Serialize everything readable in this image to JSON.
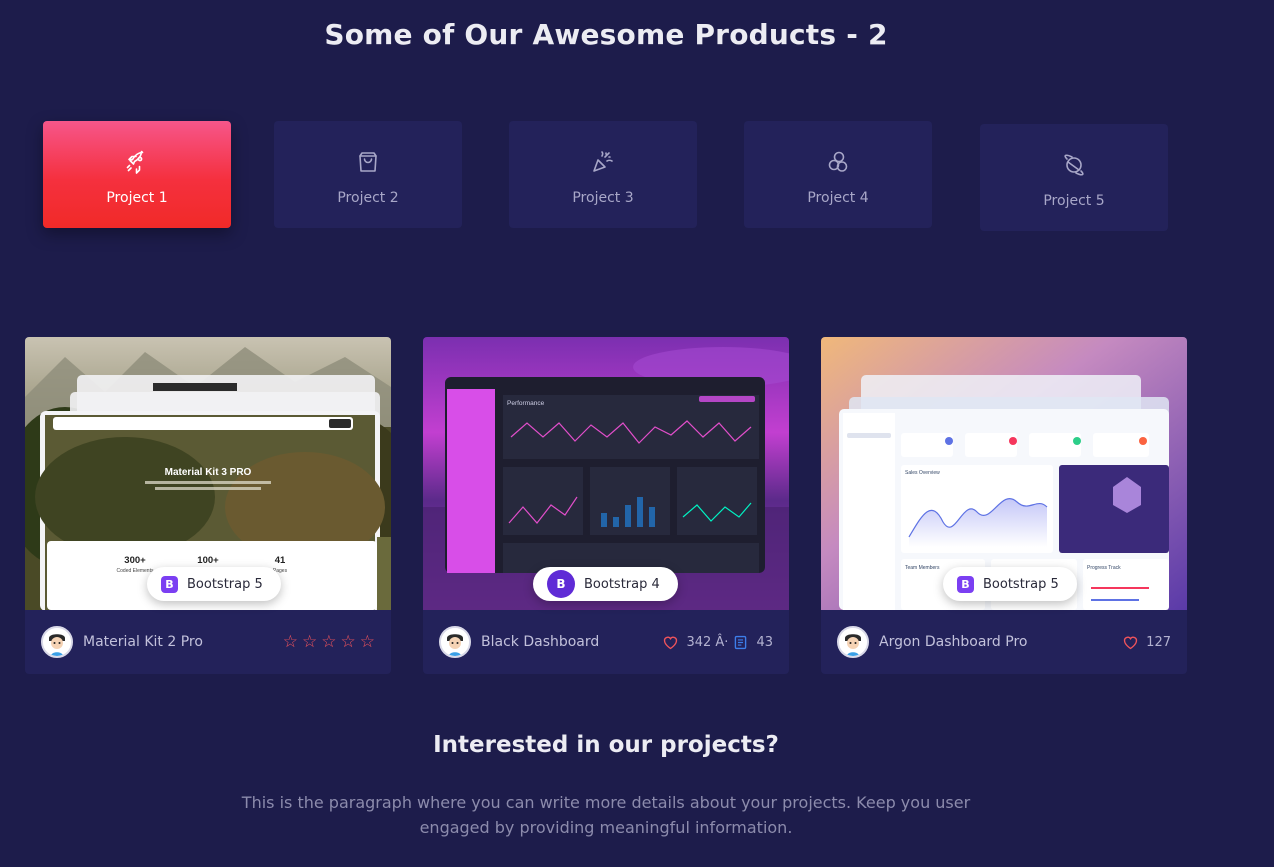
{
  "header": {
    "title": "Some of Our Awesome Products - 2"
  },
  "tabs": [
    {
      "label": "Project 1",
      "icon": "rocket-icon",
      "active": true
    },
    {
      "label": "Project 2",
      "icon": "shopping-bag-icon",
      "active": false
    },
    {
      "label": "Project 3",
      "icon": "party-popper-icon",
      "active": false
    },
    {
      "label": "Project 4",
      "icon": "hexagons-icon",
      "active": false
    },
    {
      "label": "Project 5",
      "icon": "planet-icon",
      "active": false
    }
  ],
  "products": [
    {
      "name": "Material Kit 2 Pro",
      "badge": "Bootstrap 5",
      "rating_stars": 5,
      "thumb": {
        "heading": "Material Kit 3 PRO",
        "stats": [
          {
            "value": "300+",
            "label": "Coded Elements"
          },
          {
            "value": "100+",
            "label": ""
          },
          {
            "value": "41",
            "label": "Pages"
          }
        ]
      }
    },
    {
      "name": "Black Dashboard",
      "badge": "Bootstrap 4",
      "likes": "342 Â·",
      "docs": "43",
      "thumb": {
        "heading": "Performance"
      }
    },
    {
      "name": "Argon Dashboard Pro",
      "badge": "Bootstrap 5",
      "likes": "127",
      "thumb": {
        "heading": "Sales Overview",
        "team": "Team Members",
        "progress": "Progress Track"
      }
    }
  ],
  "cta": {
    "title": "Interested in our projects?",
    "text": "This is the paragraph where you can write more details about your projects. Keep you user engaged by providing meaningful information."
  },
  "colors": {
    "background": "#1d1c4b",
    "card": "#23225a",
    "accent_start": "#f6568a",
    "accent_end": "#f12a28",
    "heart": "#f1545b",
    "docs": "#3d7eea"
  }
}
